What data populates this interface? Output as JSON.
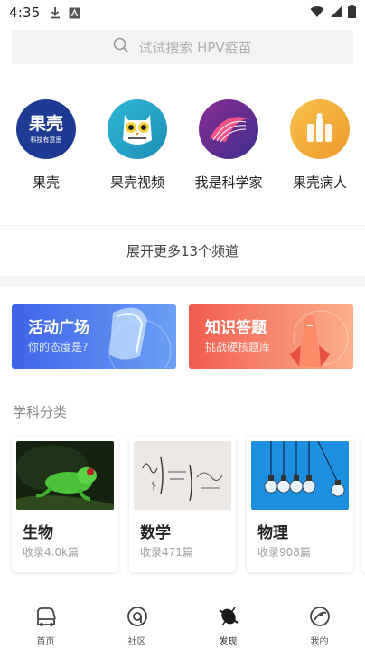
{
  "status_bar": {
    "time": "4:35"
  },
  "search": {
    "placeholder": "试试搜索 HPV疫苗"
  },
  "channels": [
    {
      "label": "果壳",
      "logo_text": "果壳",
      "logo_sub": "科技有意思",
      "color": "#1f3a93"
    },
    {
      "label": "果壳视频",
      "color": "#2aa8c9"
    },
    {
      "label": "我是科学家",
      "color": "#6b2a8c"
    },
    {
      "label": "果壳病人",
      "color": "#f3a93a"
    }
  ],
  "expand_channels": "展开更多13个频道",
  "banners": {
    "activity": {
      "title": "活动广场",
      "subtitle": "你的态度是?"
    },
    "quiz": {
      "title": "知识答题",
      "subtitle": "挑战硬核题库"
    }
  },
  "subjects": {
    "title": "学科分类",
    "items": [
      {
        "name": "生物",
        "count": "收录4.0k篇"
      },
      {
        "name": "数学",
        "count": "收录471篇"
      },
      {
        "name": "物理",
        "count": "收录908篇"
      }
    ]
  },
  "bottom_nav": [
    {
      "label": "首页",
      "active": false
    },
    {
      "label": "社区",
      "active": false
    },
    {
      "label": "发现",
      "active": true
    },
    {
      "label": "我的",
      "active": false
    }
  ],
  "colors": {
    "activity_banner_start": "#3d63e8",
    "activity_banner_end": "#6ba0f5",
    "quiz_banner_start": "#f25c4f",
    "quiz_banner_end": "#fbb08a"
  }
}
